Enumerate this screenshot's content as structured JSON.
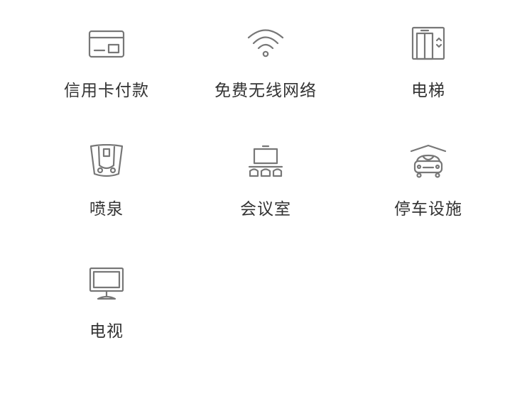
{
  "facilities": [
    {
      "label": "信用卡付款",
      "icon": "credit-card-icon"
    },
    {
      "label": "免费无线网络",
      "icon": "wifi-icon"
    },
    {
      "label": "电梯",
      "icon": "elevator-icon"
    },
    {
      "label": "喷泉",
      "icon": "fountain-icon"
    },
    {
      "label": "会议室",
      "icon": "meeting-room-icon"
    },
    {
      "label": "停车设施",
      "icon": "parking-icon"
    },
    {
      "label": "电视",
      "icon": "tv-icon"
    }
  ],
  "colors": {
    "icon": "#777777",
    "text": "#333333",
    "background": "#ffffff"
  }
}
